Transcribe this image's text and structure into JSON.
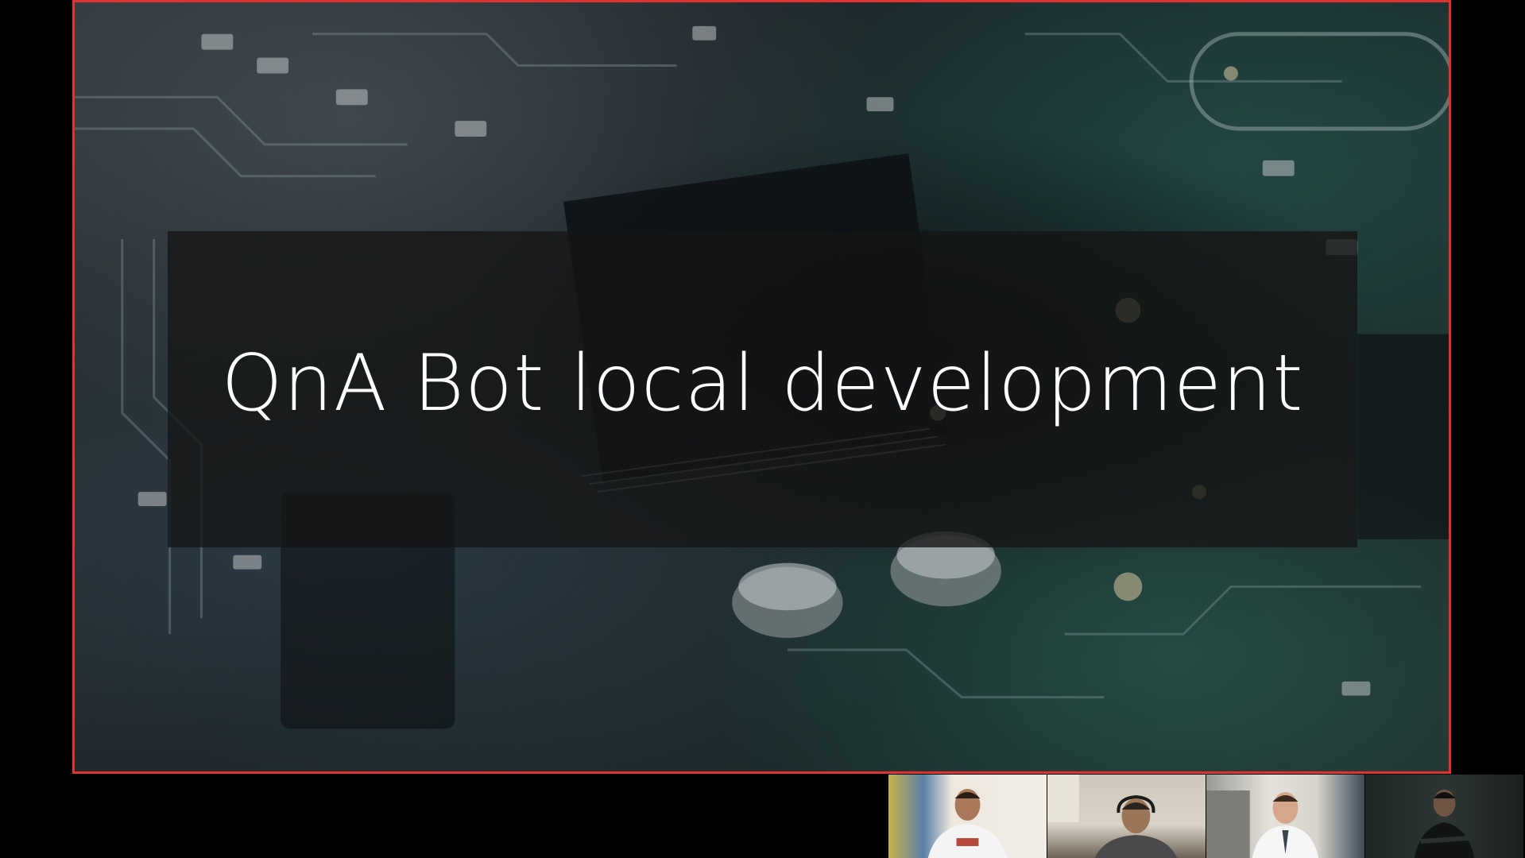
{
  "slide": {
    "title": "QnA Bot local development",
    "accent_border_color": "#e0322f"
  },
  "participants": [
    {
      "icon": "participant-video",
      "role": "speaker"
    },
    {
      "icon": "participant-video",
      "role": "attendee"
    },
    {
      "icon": "participant-video",
      "role": "attendee"
    },
    {
      "icon": "participant-video",
      "role": "attendee"
    }
  ]
}
